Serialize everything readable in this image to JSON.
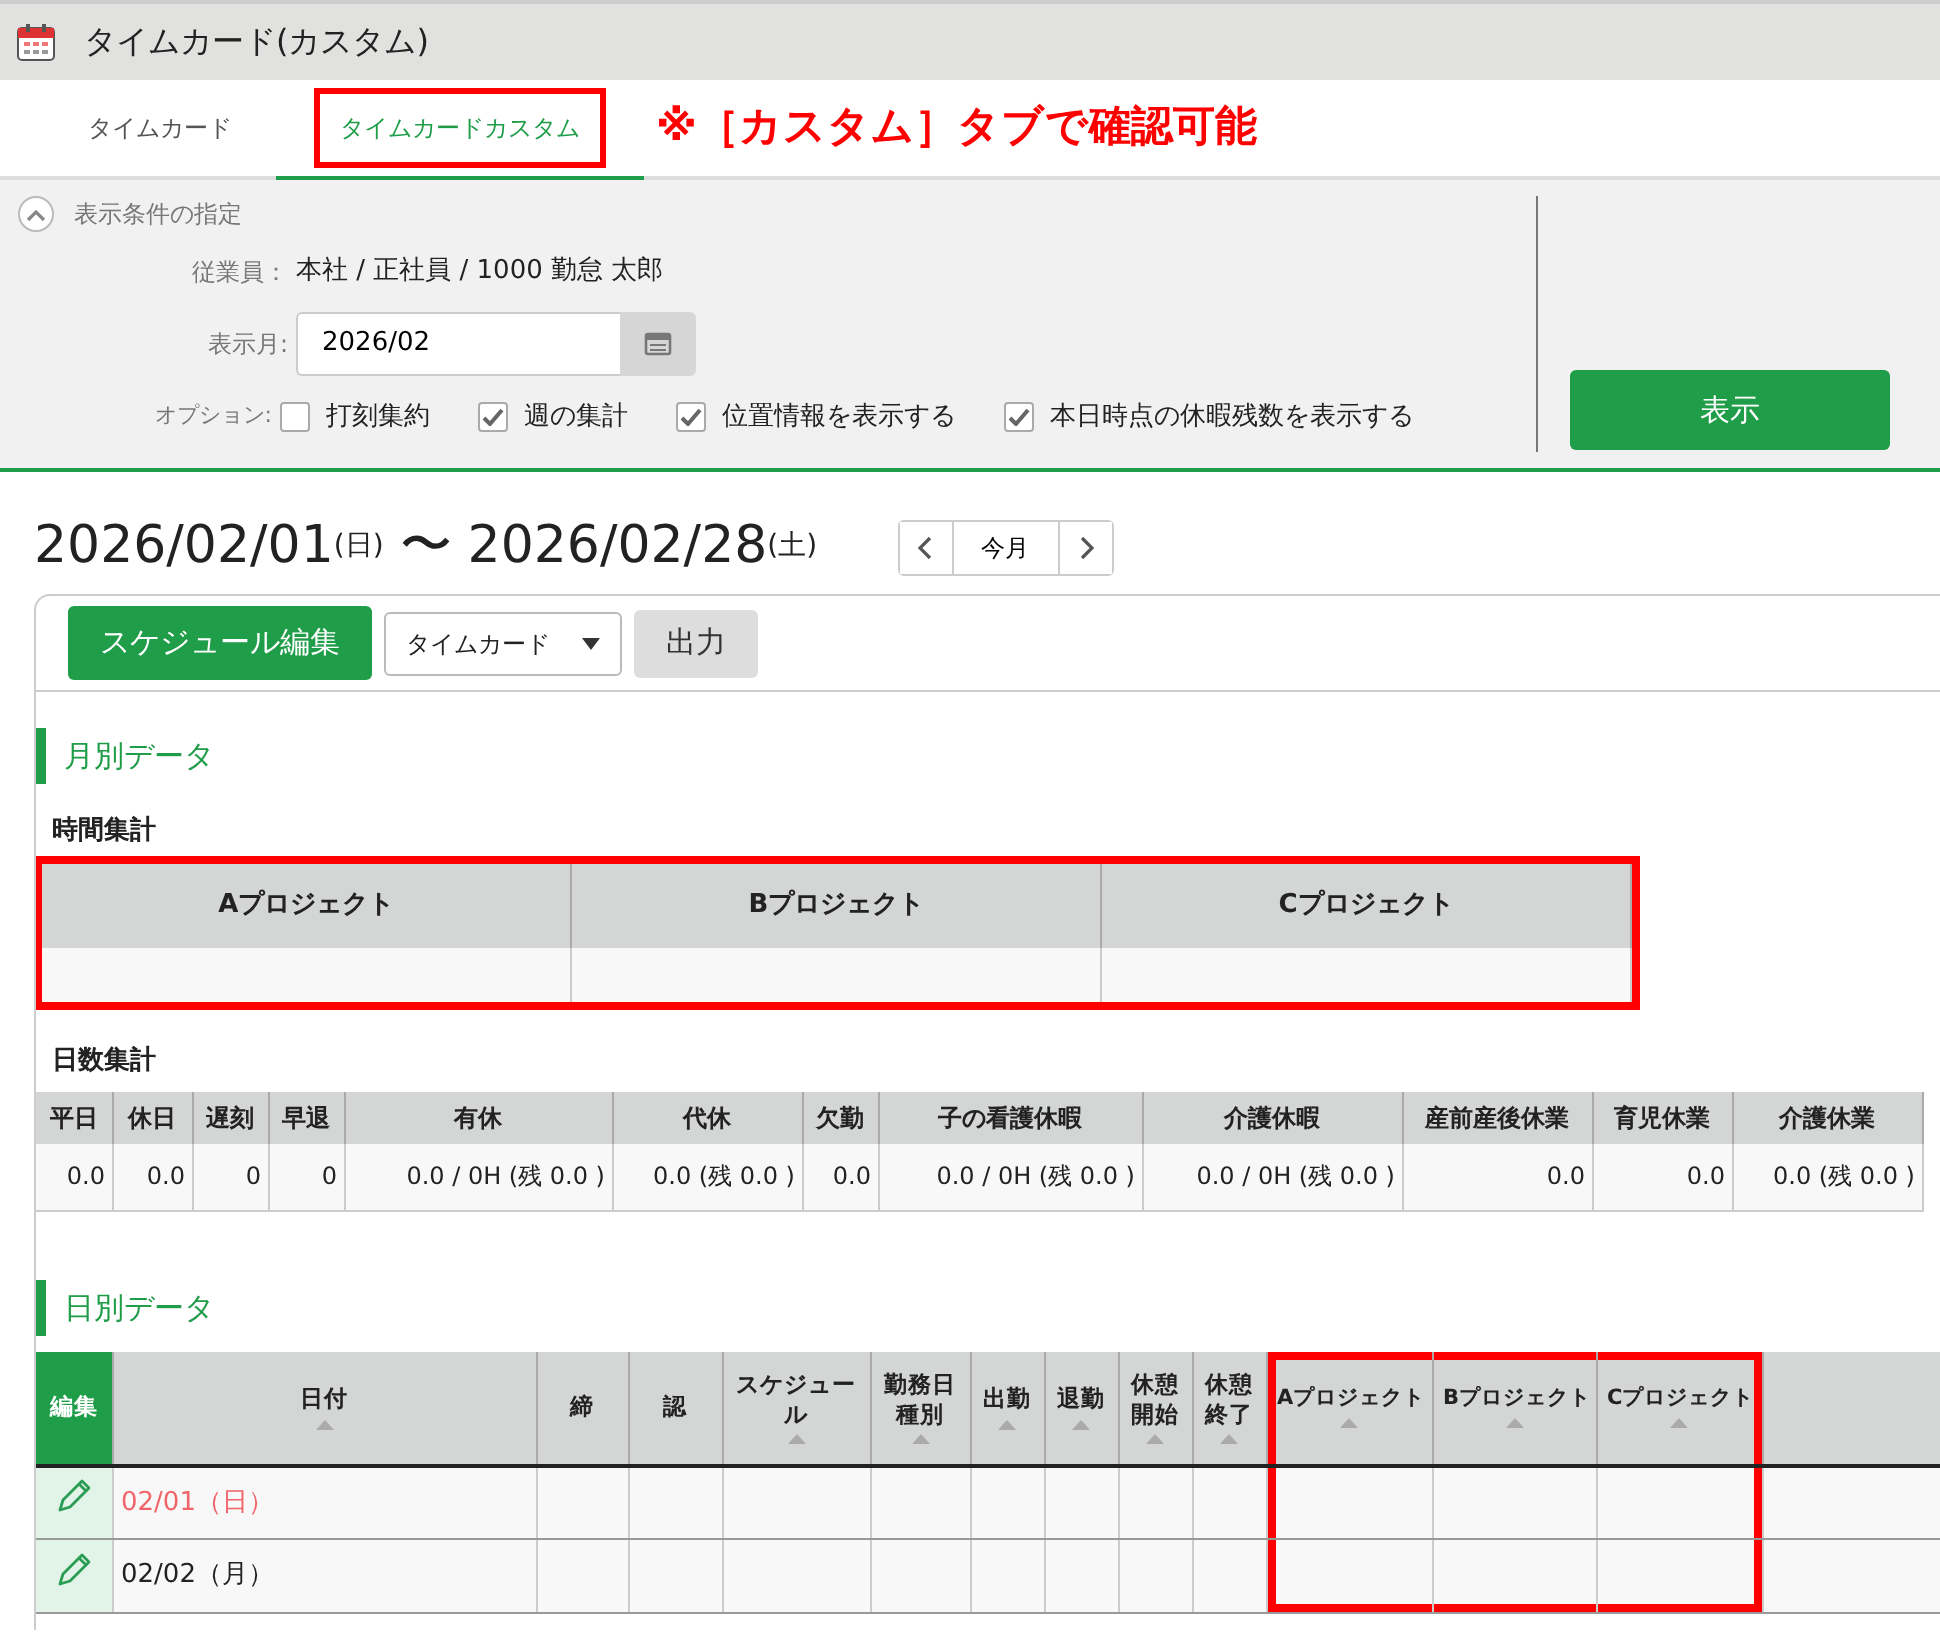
{
  "app": {
    "title": "タイムカード(カスタム)"
  },
  "tabs": [
    {
      "label": "タイムカード",
      "selected": false,
      "highlighted": false
    },
    {
      "label": "タイムカードカスタム",
      "selected": true,
      "highlighted": true
    }
  ],
  "annotation": "※［カスタム］タブで確認可能",
  "filter": {
    "heading": "表示条件の指定",
    "expanded": true,
    "employee_label": "従業員：",
    "employee": "本社 / 正社員 / 1000 勤怠 太郎",
    "month_label": "表示月:",
    "month": "2026/02",
    "options_label": "オプション:",
    "options": [
      {
        "label": "打刻集約",
        "checked": false
      },
      {
        "label": "週の集計",
        "checked": true
      },
      {
        "label": "位置情報を表示する",
        "checked": true
      },
      {
        "label": "本日時点の休暇残数を表示する",
        "checked": true
      }
    ],
    "submit": "表示"
  },
  "period": {
    "start": "2026/02/01",
    "start_day": "(日)",
    "separator": "〜",
    "end": "2026/02/28",
    "end_day": "(土)",
    "current": "今月"
  },
  "toolbar": {
    "edit": "スケジュール編集",
    "select": "タイムカード",
    "output": "出力"
  },
  "monthly": {
    "heading": "月別データ",
    "time_title": "時間集計",
    "time_highlighted": true,
    "time_columns": [
      "Aプロジェクト",
      "Bプロジェクト",
      "Cプロジェクト"
    ],
    "day_title": "日数集計",
    "day_columns": [
      "平日",
      "休日",
      "遅刻",
      "早退",
      "有休",
      "代休",
      "欠勤",
      "子の看護休暇",
      "介護休暇",
      "産前産後休業",
      "育児休業",
      "介護休業"
    ],
    "day_values": [
      "0.0",
      "0.0",
      "0",
      "0",
      "0.0 / 0H (残 0.0 )",
      "0.0 (残 0.0 )",
      "0.0",
      "0.0 / 0H (残 0.0 )",
      "0.0 / 0H (残 0.0 )",
      "0.0",
      "0.0",
      "0.0 (残 0.0 )"
    ]
  },
  "daily": {
    "heading": "日別データ",
    "columns": [
      {
        "label": "編集",
        "kind": "edit",
        "sortable": false,
        "highlighted": false
      },
      {
        "label": "日付",
        "kind": "text",
        "sortable": true,
        "highlighted": false
      },
      {
        "label": "締",
        "kind": "text",
        "sortable": false,
        "highlighted": false
      },
      {
        "label": "認",
        "kind": "text",
        "sortable": false,
        "highlighted": false
      },
      {
        "label": "スケジュール",
        "kind": "text",
        "sortable": true,
        "highlighted": false
      },
      {
        "label": "勤務日種別",
        "kind": "text",
        "sortable": true,
        "highlighted": false
      },
      {
        "label": "出勤",
        "kind": "text",
        "sortable": true,
        "highlighted": false
      },
      {
        "label": "退勤",
        "kind": "text",
        "sortable": true,
        "highlighted": false
      },
      {
        "label": "休憩開始",
        "kind": "text",
        "sortable": true,
        "highlighted": false
      },
      {
        "label": "休憩終了",
        "kind": "text",
        "sortable": true,
        "highlighted": false
      },
      {
        "label": "Aプロジェクト",
        "kind": "text",
        "sortable": true,
        "highlighted": true
      },
      {
        "label": "Bプロジェクト",
        "kind": "text",
        "sortable": true,
        "highlighted": true
      },
      {
        "label": "Cプロジェクト",
        "kind": "text",
        "sortable": true,
        "highlighted": true
      }
    ],
    "rows": [
      {
        "date": "02/01（日）",
        "holiday": true
      },
      {
        "date": "02/02（月）",
        "holiday": false
      }
    ]
  }
}
